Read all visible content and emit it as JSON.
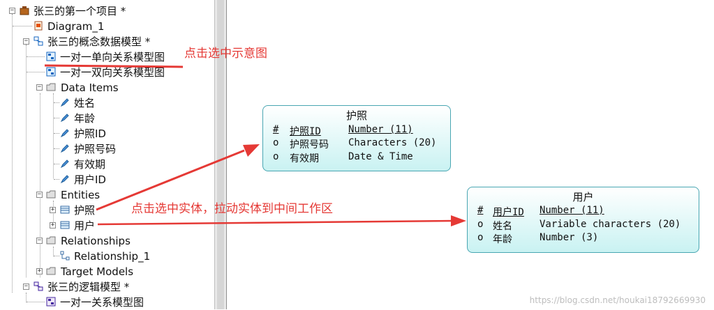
{
  "tree": {
    "project": "张三的第一个项目 *",
    "diagram": "Diagram_1",
    "cdm": "张三的概念数据模型 *",
    "diagrams": [
      "一对一单向关系模型图",
      "一对一双向关系模型图"
    ],
    "data_items_folder": "Data Items",
    "data_items": [
      "姓名",
      "年龄",
      "护照ID",
      "护照号码",
      "有效期",
      "用户ID"
    ],
    "entities_folder": "Entities",
    "entities": [
      "护照",
      "用户"
    ],
    "relationships_folder": "Relationships",
    "relationships": [
      "Relationship_1"
    ],
    "target_models_folder": "Target Models",
    "ldm": "张三的逻辑模型 *",
    "ldm_diagram": "一对一关系模型图"
  },
  "entities": {
    "passport": {
      "name": "护照",
      "attributes": [
        {
          "marker": "#",
          "name": "护照ID",
          "type": "Number (11)"
        },
        {
          "marker": "o",
          "name": "护照号码",
          "type": "Characters (20)"
        },
        {
          "marker": "o",
          "name": "有效期",
          "type": "Date & Time"
        }
      ]
    },
    "user": {
      "name": "用户",
      "attributes": [
        {
          "marker": "#",
          "name": "用户ID",
          "type": "Number (11)"
        },
        {
          "marker": "o",
          "name": "姓名",
          "type": "Variable characters (20)"
        },
        {
          "marker": "o",
          "name": "年龄",
          "type": "Number (3)"
        }
      ]
    }
  },
  "annotations": {
    "select_diagram": "点击选中示意图",
    "drag_entity": "点击选中实体，拉动实体到中间工作区"
  },
  "watermark": "https://blog.csdn.net/houkai18792669930",
  "colors": {
    "annotation": "#e53935",
    "entity_border": "#49a6b2",
    "entity_fill": "#c9f2f2"
  }
}
